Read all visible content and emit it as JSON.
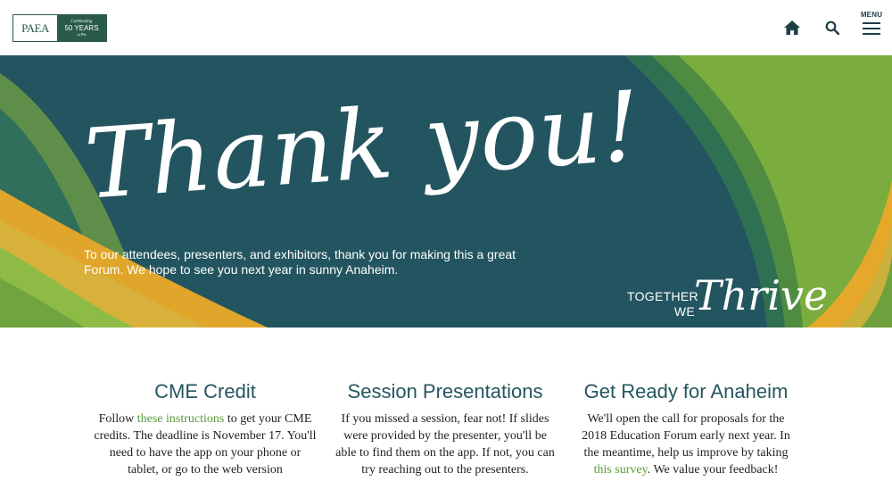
{
  "logo": {
    "mark": "PAEA",
    "celebrating": "Celebrating",
    "years": "50 YEARS",
    "sub": "of PAs"
  },
  "header": {
    "menu_label": "MENU"
  },
  "hero": {
    "title": "Thank you!",
    "message": "To our attendees, presenters, and exhibitors, thank you for making this a great Forum. We hope to see you next year in sunny Anaheim.",
    "together_line1": "TOGETHER",
    "together_line2": "WE",
    "thrive": "Thrive"
  },
  "columns": [
    {
      "title": "CME Credit",
      "before_link": "Follow ",
      "link": "these instructions",
      "after_link": " to get your CME credits. The deadline is November 17. You'll need to have the app on your phone or tablet, or go to the web version"
    },
    {
      "title": "Session Presentations",
      "text": "If you missed a session, fear not! If slides were provided by the presenter, you'll be able to find them on the app. If not, you can try reaching out to the presenters."
    },
    {
      "title": "Get Ready for Anaheim",
      "before_link": "We'll open the call for proposals for the 2018 Education Forum early next year. In the meantime, help us improve by taking ",
      "link": "this survey",
      "after_link": ". We value your feedback!"
    }
  ],
  "colors": {
    "teal": "#235560",
    "green": "#7aad3e",
    "yellow": "#e6a82a",
    "link": "#5a9a3a"
  },
  "icons": {
    "home": "home-icon",
    "search": "search-icon",
    "menu": "hamburger-icon"
  }
}
